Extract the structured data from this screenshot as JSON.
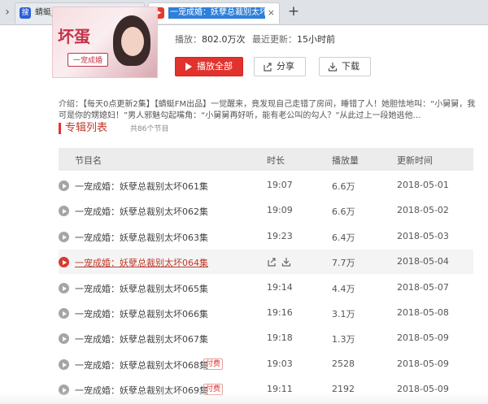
{
  "browser": {
    "tabs": [
      {
        "favicon_text": "搜",
        "label": "蜻蜓_百度搜索",
        "close": "×"
      },
      {
        "favicon_text": "▶",
        "label": "一宠成婚：妖孽总裁别太坏_",
        "close": "×"
      }
    ],
    "new_tab": "+",
    "back": "›"
  },
  "album": {
    "cover_title": "坏蛋",
    "cover_band": "一宠成婚",
    "plays_label": "播放：",
    "plays_value": "802.0万次",
    "updated_label": "最近更新：",
    "updated_value": "15小时前",
    "play_all": "播放全部",
    "share": "分享",
    "download": "下载",
    "intro": "介绍：【每天0点更新2集】【蜻蜓FM出品】一觉醒来，竟发现自己走错了房间，睡错了人！她胆怯地叫：“小舅舅，我可是你的甥媳妇！”男人邪魅勾起嘴角：“小舅舅再好听，能有老公叫的勾人？”从此过上一段她逃他…"
  },
  "section": {
    "title": "专辑列表",
    "count": "共86个节目"
  },
  "table": {
    "headers": {
      "name": "节目名",
      "duration": "时长",
      "plays": "播放量",
      "updated": "更新时间"
    },
    "rows": [
      {
        "name": "一宠成婚：妖孽总裁别太坏061集",
        "duration": "19:07",
        "plays": "6.6万",
        "updated": "2018-05-01"
      },
      {
        "name": "一宠成婚：妖孽总裁别太坏062集",
        "duration": "19:09",
        "plays": "6.6万",
        "updated": "2018-05-02"
      },
      {
        "name": "一宠成婚：妖孽总裁别太坏063集",
        "duration": "19:23",
        "plays": "6.4万",
        "updated": "2018-05-03"
      },
      {
        "name": "一宠成婚：妖孽总裁别太坏064集",
        "duration": "",
        "plays": "7.7万",
        "updated": "2018-05-04"
      },
      {
        "name": "一宠成婚：妖孽总裁别太坏065集",
        "duration": "19:14",
        "plays": "4.4万",
        "updated": "2018-05-07"
      },
      {
        "name": "一宠成婚：妖孽总裁别太坏066集",
        "duration": "19:16",
        "plays": "3.1万",
        "updated": "2018-05-08"
      },
      {
        "name": "一宠成婚：妖孽总裁别太坏067集",
        "duration": "19:18",
        "plays": "1.3万",
        "updated": "2018-05-09"
      },
      {
        "name": "一宠成婚：妖孽总裁别太坏068集",
        "paid": "付费",
        "duration": "19:03",
        "plays": "2528",
        "updated": "2018-05-09"
      },
      {
        "name": "一宠成婚：妖孽总裁别太坏069集",
        "paid": "付费",
        "duration": "19:11",
        "plays": "2192",
        "updated": "2018-05-09"
      }
    ]
  },
  "colors": {
    "accent": "#e2322d",
    "tab_highlight": "#2e7fd9"
  },
  "icons": {
    "play": "play-circle-icon",
    "share": "share-icon",
    "download": "download-icon"
  }
}
